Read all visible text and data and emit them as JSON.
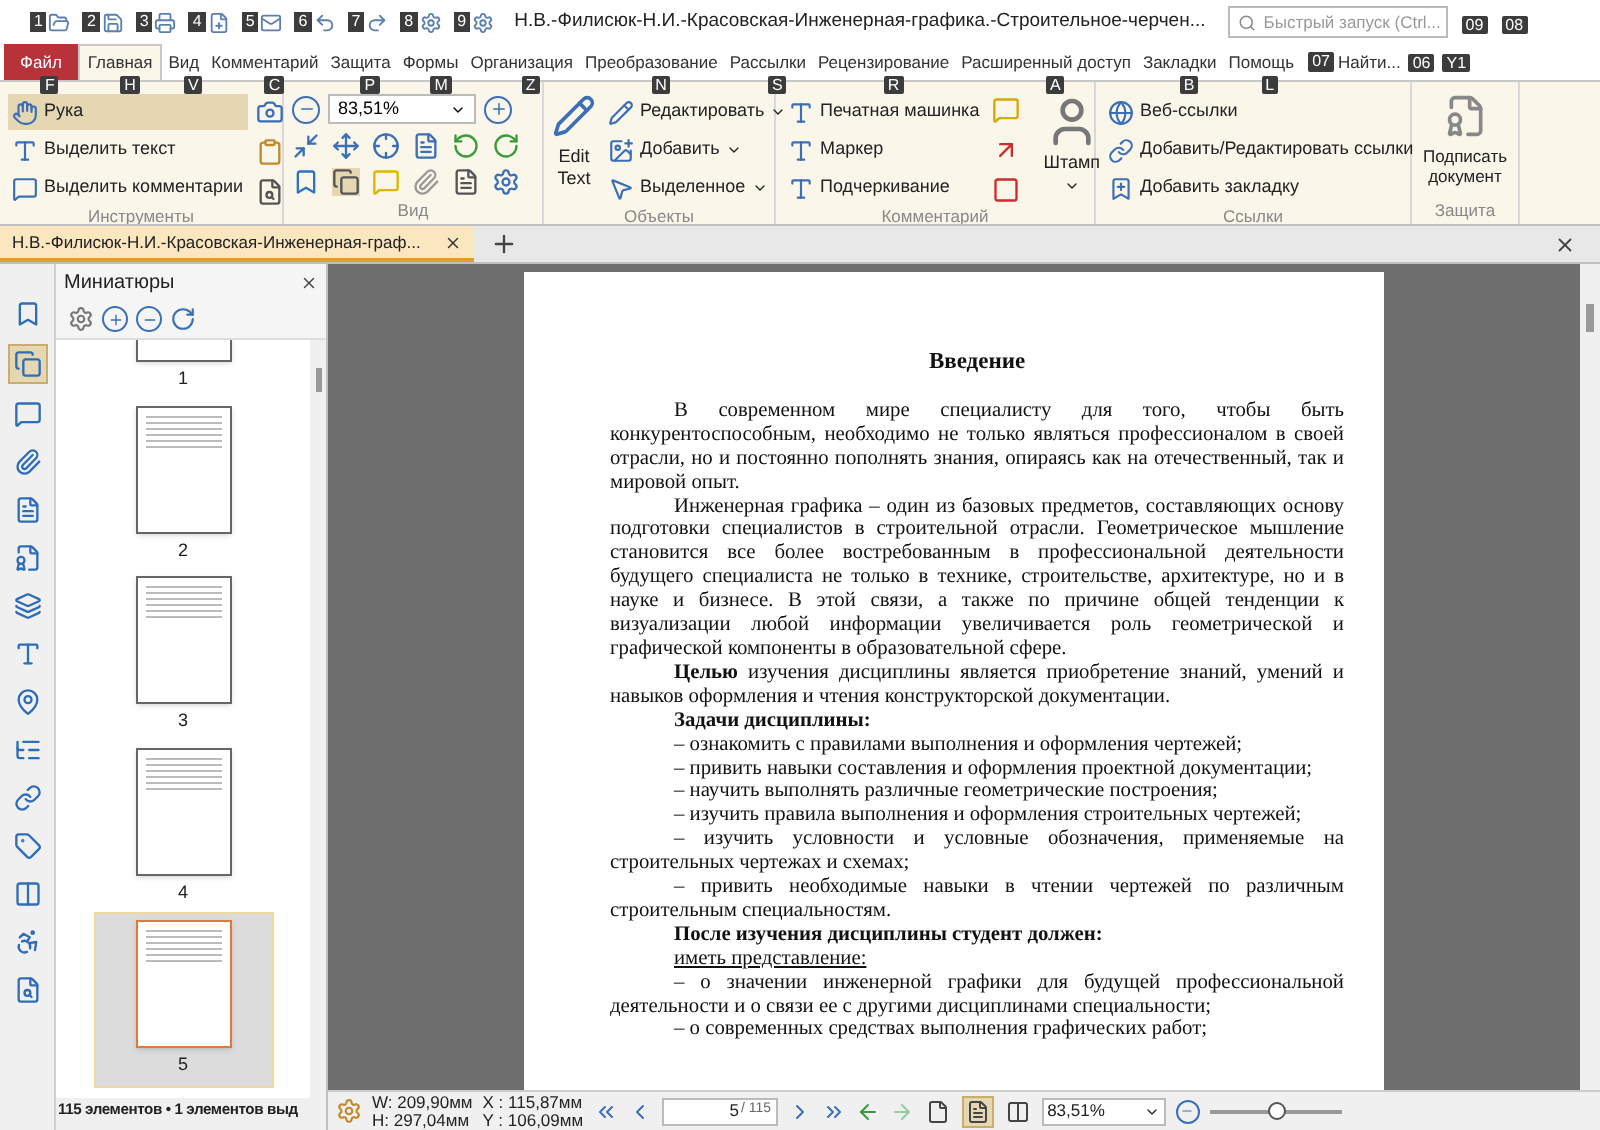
{
  "window": {
    "title": "Н.В.-Филисюк-Н.И.-Красовская-Инженерная-графика.-Строительное-черчен...",
    "search_placeholder": "Быстрый запуск (Ctrl...",
    "right_keytips": [
      "09",
      "08"
    ]
  },
  "quick_access": [
    {
      "keytip": "1"
    },
    {
      "keytip": "2"
    },
    {
      "keytip": "3"
    },
    {
      "keytip": "4"
    },
    {
      "keytip": "5"
    },
    {
      "keytip": "6"
    },
    {
      "keytip": "7"
    },
    {
      "keytip": "8"
    },
    {
      "keytip": "9"
    }
  ],
  "tabs": [
    {
      "label": "Файл",
      "keytip": "F",
      "kind": "file",
      "selected": false
    },
    {
      "label": "Главная",
      "keytip": "H",
      "kind": "tab",
      "selected": true
    },
    {
      "label": "Вид",
      "keytip": "V",
      "kind": "tab",
      "selected": false
    },
    {
      "label": "Комментарий",
      "keytip": "C",
      "kind": "tab",
      "selected": false
    },
    {
      "label": "Защита",
      "keytip": "P",
      "kind": "tab",
      "selected": false
    },
    {
      "label": "Формы",
      "keytip": "M",
      "kind": "tab",
      "selected": false
    },
    {
      "label": "Организация",
      "keytip": "Z",
      "kind": "tab",
      "selected": false
    },
    {
      "label": "Преобразование",
      "keytip": "N",
      "kind": "tab",
      "selected": false
    },
    {
      "label": "Рассылки",
      "keytip": "S",
      "kind": "tab",
      "selected": false
    },
    {
      "label": "Рецензирование",
      "keytip": "R",
      "kind": "tab",
      "selected": false
    },
    {
      "label": "Расширенный доступ",
      "keytip": "A",
      "kind": "tab",
      "selected": false
    },
    {
      "label": "Закладки",
      "keytip": "B",
      "kind": "tab",
      "selected": false
    },
    {
      "label": "Помощь",
      "keytip": "L",
      "kind": "tab",
      "selected": false
    }
  ],
  "find": {
    "label": "Найти...",
    "keytip": "07",
    "trailing_keytips": [
      "06",
      "Y1"
    ]
  },
  "ribbon": [
    {
      "kind": "tools",
      "label": "Инструменты",
      "items": [
        {
          "label": "Рука",
          "selected": true
        },
        {
          "label": "Выделить текст",
          "selected": false
        },
        {
          "label": "Выделить комментарии",
          "selected": false
        }
      ]
    },
    {
      "kind": "view",
      "label": "Вид",
      "zoom": "83,51%"
    },
    {
      "kind": "objects",
      "label": "Объекты",
      "big": "Edit Text",
      "items": [
        "Редактировать",
        "Добавить",
        "Выделенное"
      ]
    },
    {
      "kind": "comment",
      "label": "Комментарий",
      "items": [
        "Печатная машинка",
        "Маркер",
        "Подчеркивание"
      ],
      "big": "Штамп"
    },
    {
      "kind": "links",
      "label": "Ссылки",
      "items": [
        "Веб-ссылки",
        "Добавить/Редактировать ссылки",
        "Добавить закладку"
      ]
    },
    {
      "kind": "protect",
      "label": "Защита",
      "big": "Подписать документ"
    }
  ],
  "document_tab": {
    "label": "Н.В.-Филисюк-Н.И.-Красовская-Инженерная-граф..."
  },
  "left_strip": [
    {
      "selected": false
    },
    {
      "selected": true
    },
    {
      "selected": false
    },
    {
      "selected": false
    },
    {
      "selected": false
    },
    {
      "selected": false
    },
    {
      "selected": false
    },
    {
      "selected": false
    },
    {
      "selected": false
    },
    {
      "selected": false
    },
    {
      "selected": false
    },
    {
      "selected": false
    },
    {
      "selected": false
    },
    {
      "selected": false
    },
    {
      "selected": false
    }
  ],
  "thumbnails_panel": {
    "title": "Миниатюры",
    "pages": [
      {
        "label": "1",
        "selected": false
      },
      {
        "label": "2",
        "selected": false
      },
      {
        "label": "3",
        "selected": false
      },
      {
        "label": "4",
        "selected": false
      },
      {
        "label": "5",
        "selected": true
      }
    ],
    "footer": "115 элементов • 1 элементов выд"
  },
  "document": [
    {
      "kind": "heading",
      "text": "Введение"
    },
    {
      "kind": "paragraph",
      "text": "В современном мире специалисту для того, чтобы быть конкурентоспособным, необходимо не только являться профессионалом  в своей отрасли, но и постоянно пополнять  знания, опираясь как на отечественный, так и мировой опыт."
    },
    {
      "kind": "paragraph",
      "text": "Инженерная графика – один из базовых предметов, составляющих основу подготовки специалистов в строительной отрасли. Геометрическое мышление становится все более востребованным в профессиональной деятельности будущего специалиста не только в технике, строительстве, архитектуре, но и в науке и бизнесе. В этой связи, а также по причине общей тенденции к визуализации любой информации увеличивается роль геометрической и графической компоненты в образовательной сфере."
    },
    {
      "kind": "paragraph",
      "text": "**Целью** изучения дисциплины является приобретение знаний, умений и навыков оформления и чтения конструкторской документации."
    },
    {
      "kind": "bold",
      "text": "Задачи дисциплины:"
    },
    {
      "kind": "paragraph",
      "text": "– ознакомить с правилами выполнения и оформления чертежей;"
    },
    {
      "kind": "paragraph",
      "text": "– привить навыки составления и оформления проектной документации;"
    },
    {
      "kind": "paragraph",
      "text": "– научить выполнять различные геометрические построения;"
    },
    {
      "kind": "paragraph",
      "text": "– изучить правила выполнения и оформления строительных чертежей;"
    },
    {
      "kind": "paragraph",
      "text": "– изучить условности и условные обозначения, применяемые на строительных чертежах и схемах;"
    },
    {
      "kind": "paragraph",
      "text": "– привить необходимые навыки в чтении чертежей по различным строительным специальностям."
    },
    {
      "kind": "bold",
      "text": "После изучения дисциплины студент должен:"
    },
    {
      "kind": "underlined",
      "text": "иметь представление:"
    },
    {
      "kind": "paragraph",
      "text": "– о значении инженерной графики для будущей профессиональной деятельности и о связи ее с другими дисциплинами специальности;"
    },
    {
      "kind": "paragraph",
      "text": "– о современных средствах выполнения графических работ;"
    }
  ],
  "status_bar": {
    "width": "W: 209,90мм",
    "height": "H: 297,04мм",
    "x": "X : 115,87мм",
    "y": "Y : 106,09мм",
    "page": "5",
    "page_total": "/ 115",
    "view_modes": [
      {
        "selected": false
      },
      {
        "selected": true
      },
      {
        "selected": false
      }
    ],
    "zoom": "83,51%",
    "zoom_slider": {
      "level": 0.5
    }
  }
}
